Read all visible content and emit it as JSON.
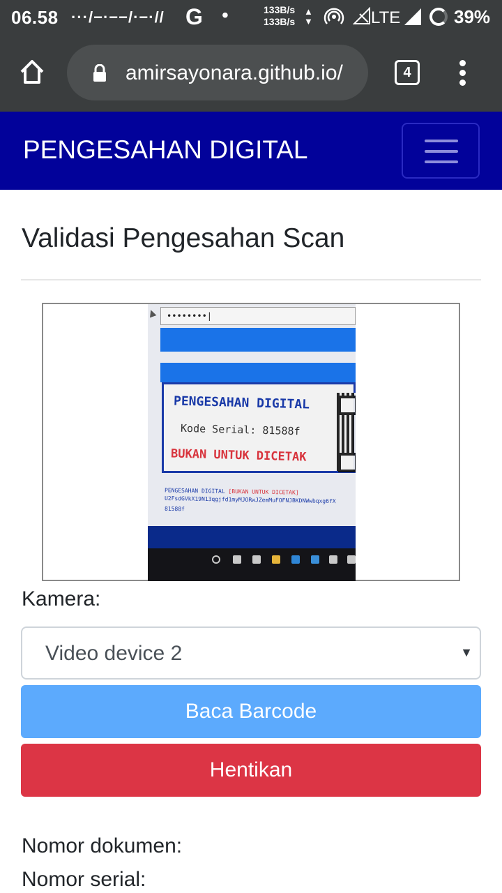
{
  "status_bar": {
    "time": "06.58",
    "network_morse": "···/−·−−/·−·//",
    "google_glyph": "G",
    "dot": "•",
    "speed_up": "133B/s",
    "speed_down": "133B/s",
    "network_type": "LTE",
    "battery": "39%"
  },
  "browser": {
    "url": "amirsayonara.github.io/",
    "tab_count": "4"
  },
  "navbar": {
    "brand": "PENGESAHAN DIGITAL"
  },
  "main": {
    "title": "Validasi Pengesahan Scan",
    "camera_preview": {
      "password_dots": "••••••••|",
      "stamp_title": "PENGESAHAN DIGITAL",
      "stamp_serial": "Kode Serial: 81588f",
      "stamp_warning": "BUKAN UNTUK DICETAK",
      "line1_blue": "PENGESAHAN DIGITAL ",
      "line1_red": "[BUKAN UNTUK DICETAK]",
      "line2": "U2FsdGVkX19N13qgjfd1myMJORwJZemMuFOFNJBKDNWwbqxg6fX",
      "line3": "81588f"
    },
    "camera_label": "Kamera:",
    "camera_select_value": "Video device 2",
    "read_button": "Baca Barcode",
    "stop_button": "Hentikan",
    "document_number_label": "Nomor dokumen:",
    "serial_number_label": "Nomor serial:"
  },
  "colors": {
    "navbar_bg": "#02029a",
    "read_button_bg": "#5caafd",
    "stop_button_bg": "#dc3545",
    "browser_chrome": "#3a3d3e"
  }
}
